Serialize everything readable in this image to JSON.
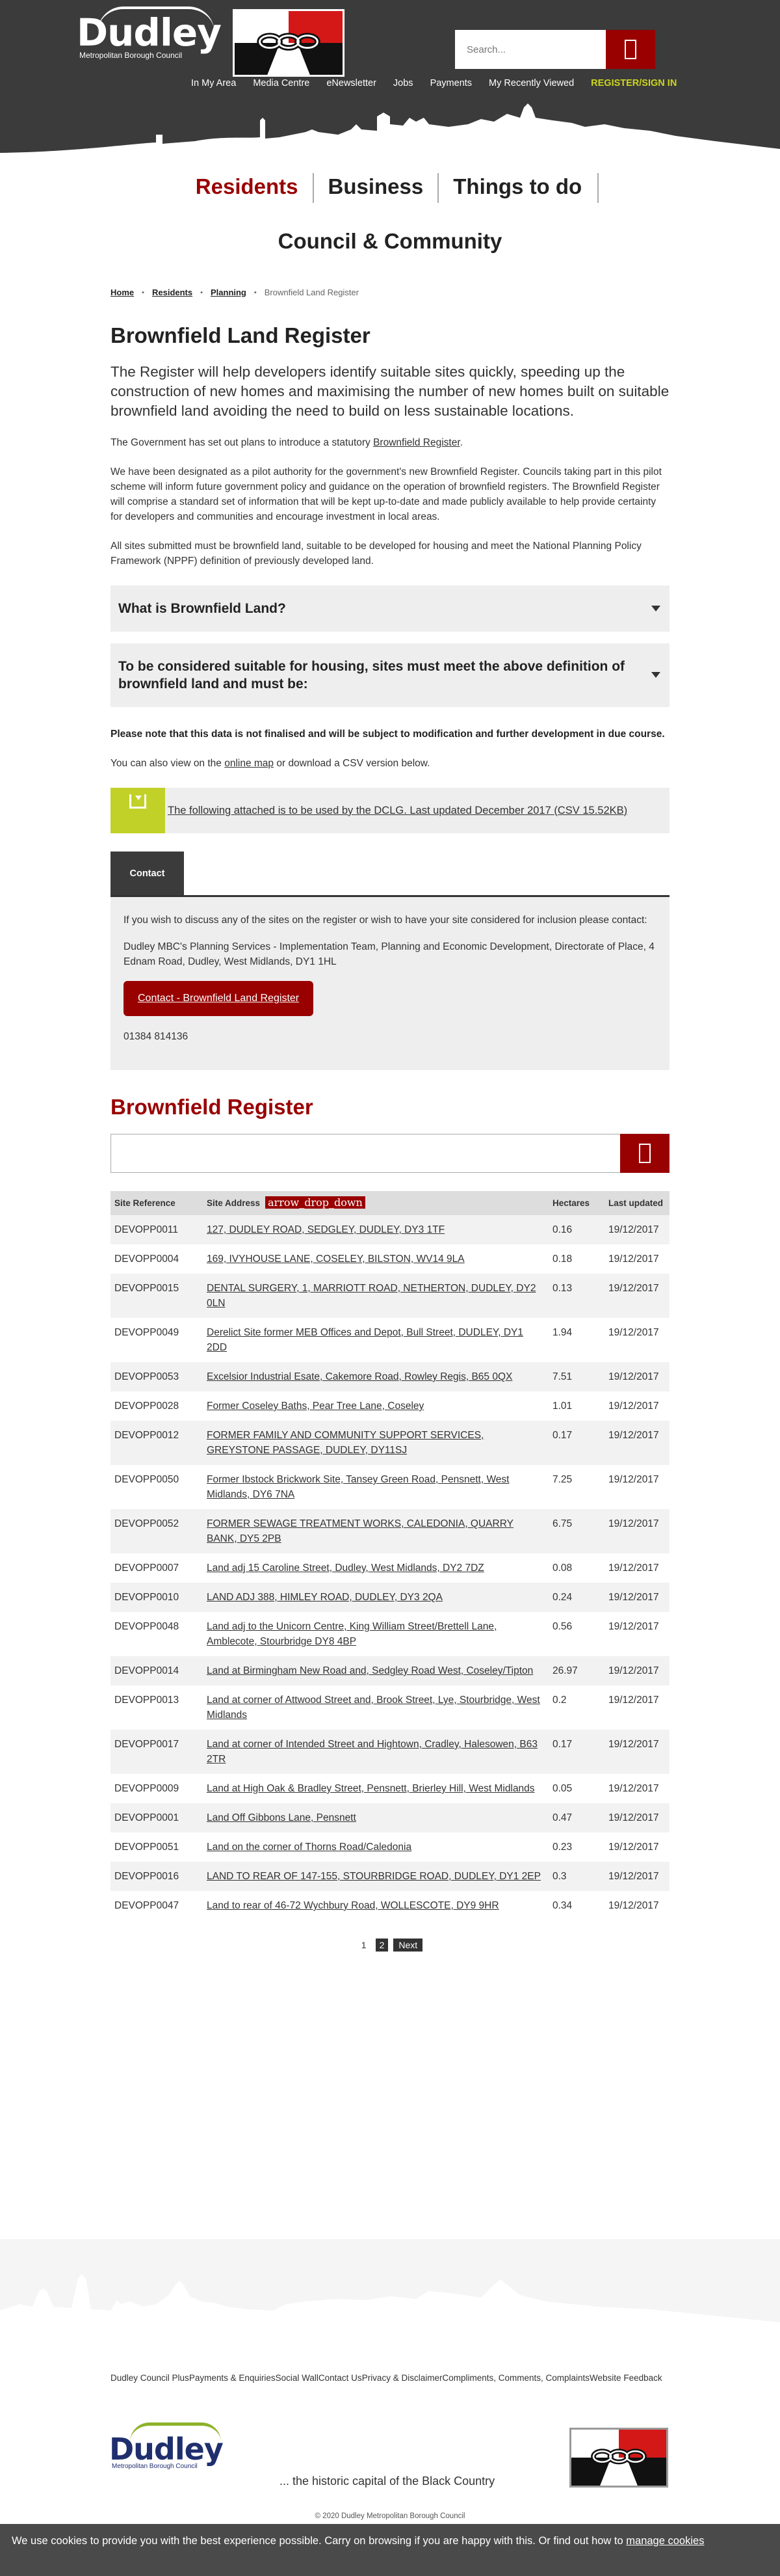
{
  "header": {
    "logo_word": "Dudley",
    "logo_sub": "Metropolitan Borough Council",
    "search_placeholder": "Search...",
    "nav": [
      "In My Area",
      "Media Centre",
      "eNewsletter",
      "Jobs",
      "Payments",
      "My Recently Viewed"
    ],
    "register_label": "REGISTER/SIGN IN"
  },
  "sections": {
    "residents": "Residents",
    "business": "Business",
    "things_to_do": "Things to do",
    "council": "Council & Community"
  },
  "breadcrumb": {
    "home": "Home",
    "residents": "Residents",
    "planning": "Planning",
    "current": "Brownfield Land Register"
  },
  "page": {
    "title": "Brownfield Land Register",
    "lead": "The Register will help developers identify suitable sites quickly, speeding up the construction of new homes and maximising the number of new homes built on suitable brownfield land avoiding the need to build on less sustainable locations.",
    "para1_pre": "The Government has set out plans to introduce a statutory ",
    "para1_link": "Brownfield Register",
    "para1_post": ".",
    "para2": "We have been designated as a pilot authority for the government's new Brownfield Register. Councils taking part in this pilot scheme will inform future government policy and guidance on the operation of brownfield registers. The Brownfield Register will comprise a standard set of information that will be kept up-to-date and made publicly available to help provide certainty for developers and communities and encourage investment in local areas.",
    "para3": "All sites submitted must be brownfield land, suitable to be developed for housing and meet the National Planning Policy Framework (NPPF) definition of previously developed land.",
    "accordion1": "What is Brownfield Land?",
    "accordion2": "To be considered suitable for housing, sites must meet the above definition of brownfield land and must be:",
    "note": "Please note that this data is not finalised and will be subject to modification and further development in due course.",
    "view_pre": "You can also view on the ",
    "view_link": "online map",
    "view_post": " or download a CSV version below.",
    "download_text": "The following attached is to be used by the DCLG. Last updated December 2017 (CSV 15.52KB)"
  },
  "contact": {
    "tab_label": "Contact",
    "p1": "If you wish to discuss any of the sites on the register or wish to have your site considered for inclusion please contact:",
    "p2": "Dudley MBC's Planning Services - Implementation Team, Planning and Economic Development, Directorate of Place, 4 Ednam Road, Dudley, West Midlands, DY1 1HL",
    "button": "Contact - Brownfield Land Register",
    "phone": "01384 814136"
  },
  "register": {
    "title": "Brownfield Register",
    "headers": {
      "ref": "Site Reference",
      "addr": "Site Address",
      "sort_label": "arrow_drop_down",
      "ha": "Hectares",
      "updated": "Last updated"
    },
    "rows": [
      {
        "ref": "DEVOPP0011",
        "addr": "127, DUDLEY ROAD, SEDGLEY, DUDLEY, DY3 1TF",
        "ha": "0.16",
        "updated": "19/12/2017"
      },
      {
        "ref": "DEVOPP0004",
        "addr": "169, IVYHOUSE LANE, COSELEY, BILSTON, WV14 9LA",
        "ha": "0.18",
        "updated": "19/12/2017"
      },
      {
        "ref": "DEVOPP0015",
        "addr": "DENTAL SURGERY, 1, MARRIOTT ROAD, NETHERTON, DUDLEY, DY2 0LN",
        "ha": "0.13",
        "updated": "19/12/2017"
      },
      {
        "ref": "DEVOPP0049",
        "addr": "Derelict Site former MEB Offices and Depot, Bull Street, DUDLEY, DY1 2DD",
        "ha": "1.94",
        "updated": "19/12/2017"
      },
      {
        "ref": "DEVOPP0053",
        "addr": "Excelsior Industrial Esate, Cakemore Road, Rowley Regis, B65 0QX",
        "ha": "7.51",
        "updated": "19/12/2017"
      },
      {
        "ref": "DEVOPP0028",
        "addr": "Former Coseley Baths, Pear Tree Lane, Coseley",
        "ha": "1.01",
        "updated": "19/12/2017"
      },
      {
        "ref": "DEVOPP0012",
        "addr": "FORMER FAMILY AND COMMUNITY SUPPORT SERVICES, GREYSTONE PASSAGE, DUDLEY, DY11SJ",
        "ha": "0.17",
        "updated": "19/12/2017"
      },
      {
        "ref": "DEVOPP0050",
        "addr": "Former Ibstock Brickwork Site, Tansey Green Road, Pensnett, West Midlands, DY6 7NA",
        "ha": "7.25",
        "updated": "19/12/2017"
      },
      {
        "ref": "DEVOPP0052",
        "addr": "FORMER SEWAGE TREATMENT WORKS, CALEDONIA, QUARRY BANK, DY5 2PB",
        "ha": "6.75",
        "updated": "19/12/2017"
      },
      {
        "ref": "DEVOPP0007",
        "addr": "Land adj 15 Caroline Street, Dudley, West Midlands, DY2 7DZ",
        "ha": "0.08",
        "updated": "19/12/2017"
      },
      {
        "ref": "DEVOPP0010",
        "addr": "LAND ADJ 388, HIMLEY ROAD, DUDLEY, DY3 2QA",
        "ha": "0.24",
        "updated": "19/12/2017"
      },
      {
        "ref": "DEVOPP0048",
        "addr": "Land adj to the Unicorn Centre, King William Street/Brettell Lane, Amblecote, Stourbridge DY8 4BP",
        "ha": "0.56",
        "updated": "19/12/2017"
      },
      {
        "ref": "DEVOPP0014",
        "addr": "Land at Birmingham New Road and, Sedgley Road West, Coseley/Tipton",
        "ha": "26.97",
        "updated": "19/12/2017"
      },
      {
        "ref": "DEVOPP0013",
        "addr": "Land at corner of Attwood Street and, Brook Street, Lye, Stourbridge, West Midlands",
        "ha": "0.2",
        "updated": "19/12/2017"
      },
      {
        "ref": "DEVOPP0017",
        "addr": "Land at corner of Intended Street and Hightown, Cradley, Halesowen, B63 2TR",
        "ha": "0.17",
        "updated": "19/12/2017"
      },
      {
        "ref": "DEVOPP0009",
        "addr": "Land at High Oak & Bradley Street, Pensnett, Brierley Hill, West Midlands",
        "ha": "0.05",
        "updated": "19/12/2017"
      },
      {
        "ref": "DEVOPP0001",
        "addr": "Land Off Gibbons Lane, Pensnett",
        "ha": "0.47",
        "updated": "19/12/2017"
      },
      {
        "ref": "DEVOPP0051",
        "addr": "Land on the corner of Thorns Road/Caledonia",
        "ha": "0.23",
        "updated": "19/12/2017"
      },
      {
        "ref": "DEVOPP0016",
        "addr": "LAND TO REAR OF 147-155, STOURBRIDGE ROAD, DUDLEY, DY1 2EP",
        "ha": "0.3",
        "updated": "19/12/2017"
      },
      {
        "ref": "DEVOPP0047",
        "addr": "Land to rear of 46-72 Wychbury Road, WOLLESCOTE, DY9 9HR",
        "ha": "0.34",
        "updated": "19/12/2017"
      }
    ],
    "pagination": {
      "page1": "1",
      "page2": "2",
      "next": "Next"
    }
  },
  "footer": {
    "links": [
      "Dudley Council Plus",
      "Payments & Enquiries",
      "Social Wall",
      "Contact Us",
      "Privacy & Disclaimer",
      "Compliments, Comments, Complaints",
      "Website Feedback"
    ],
    "logo_word": "Dudley",
    "logo_sub": "Metropolitan Borough Council",
    "tagline": "... the historic capital of the Black Country",
    "copyright": "© 2020 Dudley Metropolitan Borough Council"
  },
  "cookie": {
    "text": "We use cookies to provide you with the best experience possible. Carry on browsing if you are happy with this. Or find out how to ",
    "link": "manage cookies"
  },
  "colors": {
    "brand_red": "#990000",
    "header_bg": "#3b3b3b",
    "accent_green": "#c2d127",
    "register_link": "#ccd51c"
  },
  "icons": {
    "search": "search-icon",
    "download": "download-icon",
    "chevron": "chevron-down-icon"
  }
}
